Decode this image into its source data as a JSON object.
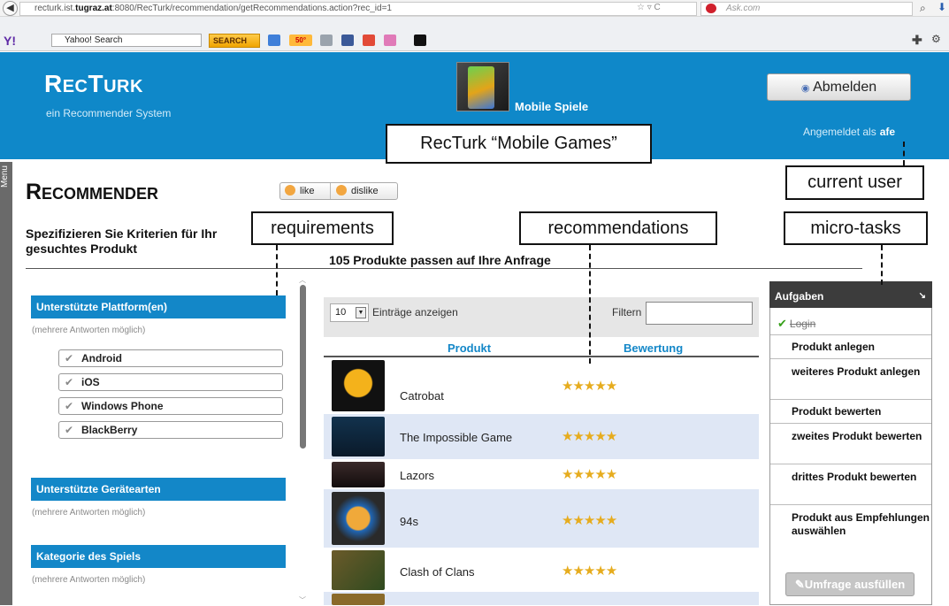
{
  "browser": {
    "url_host_prefix": "recturk.ist.",
    "url_host_bold": "tugraz.at",
    "url_rest": ":8080/RecTurk/recommendation/getRecommendations.action?rec_id=1",
    "search_engine_placeholder": "Ask.com",
    "yahoo_logo": "Y!",
    "yahoo_search_placeholder": "Yahoo! Search",
    "yahoo_search_button": "SEARCH",
    "weather_badge": "50°"
  },
  "header": {
    "logo": "RecTurk",
    "tagline": "ein Recommender System",
    "category_name": "Mobile Spiele",
    "logout_button": "Abmelden",
    "logged_in_label": "Angemeldet als",
    "username": "afe"
  },
  "annotations": {
    "title": "RecTurk “Mobile Games”",
    "current_user": "current user",
    "requirements": "requirements",
    "recommendations": "recommendations",
    "micro_tasks": "micro-tasks"
  },
  "side_menu_label": "Menu",
  "page": {
    "title": "Recommender",
    "like_label": "like",
    "dislike_label": "dislike",
    "criteria_heading": "Spezifizieren Sie Kriterien für Ihr gesuchtes Produkt",
    "result_count": "105 Produkte passen auf Ihre Anfrage"
  },
  "filters": [
    {
      "title": "Unterstützte Plattform(en)",
      "hint": "(mehrere Antworten möglich)",
      "options": [
        "Android",
        "iOS",
        "Windows Phone",
        "BlackBerry"
      ]
    },
    {
      "title": "Unterstützte Gerätearten",
      "hint": "(mehrere Antworten möglich)",
      "options": []
    },
    {
      "title": "Kategorie des Spiels",
      "hint": "(mehrere Antworten möglich)",
      "options": []
    }
  ],
  "table": {
    "page_size": "10",
    "page_size_label": "Einträge anzeigen",
    "filter_label": "Filtern",
    "columns": [
      "Produkt",
      "Bewertung"
    ],
    "rows": [
      {
        "name": "Catrobat",
        "rating": "★★★★★"
      },
      {
        "name": "The Impossible Game",
        "rating": "★★★★★"
      },
      {
        "name": "Lazors",
        "rating": "★★★★★"
      },
      {
        "name": "94s",
        "rating": "★★★★★"
      },
      {
        "name": "Clash of Clans",
        "rating": "★★★★★"
      }
    ]
  },
  "tasks": {
    "title": "Aufgaben",
    "items": [
      {
        "label": "Login",
        "done": true
      },
      {
        "label": "Produkt anlegen",
        "done": false
      },
      {
        "label": "weiteres Produkt anlegen",
        "done": false
      },
      {
        "label": "Produkt bewerten",
        "done": false
      },
      {
        "label": "zweites Produkt bewerten",
        "done": false
      },
      {
        "label": "drittes Produkt bewerten",
        "done": false
      },
      {
        "label": "Produkt aus Empfehlungen auswählen",
        "done": false
      }
    ],
    "survey_button": "Umfrage ausfüllen"
  },
  "colors": {
    "header_bg": "#0f88c9",
    "section_bg": "#1387c8",
    "alt_row": "#dfe7f5",
    "star": "#e6ac1e"
  }
}
